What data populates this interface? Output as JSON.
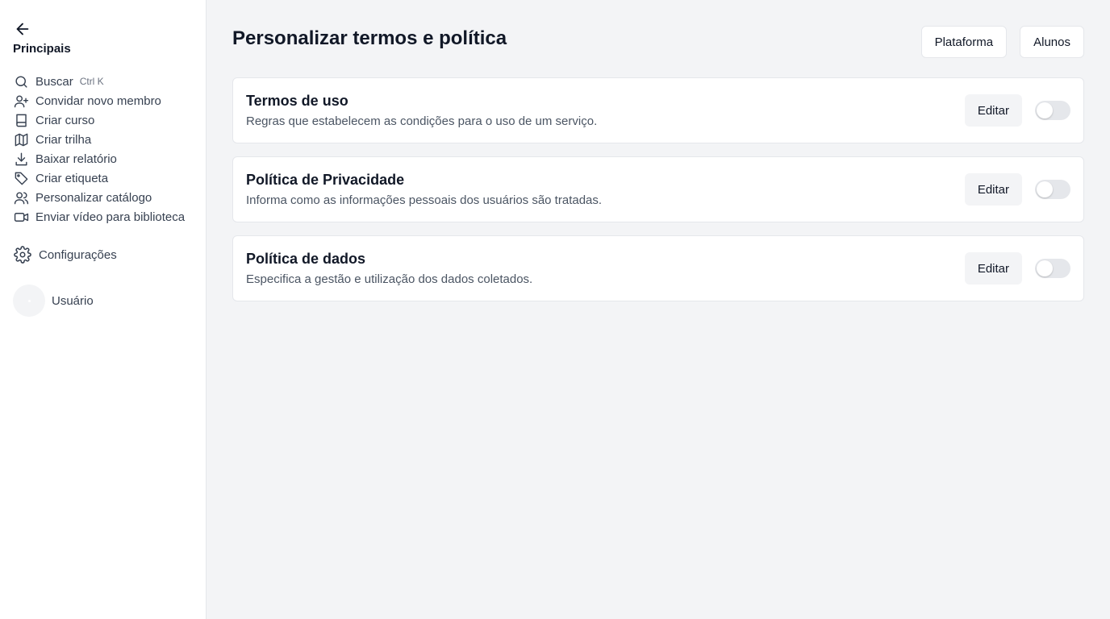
{
  "sidebar": {
    "section_title": "Principais",
    "items": [
      {
        "label": "Buscar",
        "icon": "search-icon",
        "shortcut": "Ctrl K"
      },
      {
        "label": "Convidar novo membro",
        "icon": "user-plus-icon"
      },
      {
        "label": "Criar curso",
        "icon": "book-icon"
      },
      {
        "label": "Criar trilha",
        "icon": "map-icon"
      },
      {
        "label": "Baixar relatório",
        "icon": "download-icon"
      },
      {
        "label": "Criar etiqueta",
        "icon": "tag-icon"
      },
      {
        "label": "Personalizar catálogo",
        "icon": "users-icon"
      },
      {
        "label": "Enviar vídeo para biblioteca",
        "icon": "video-icon"
      }
    ],
    "settings_label": "Configurações",
    "user_name": "Usuário"
  },
  "main": {
    "title": "Personalizar termos e política",
    "header_buttons": {
      "platform": "Plataforma",
      "students": "Alunos"
    },
    "cards": [
      {
        "title": "Termos de uso",
        "description": "Regras que estabelecem as condições para o uso de um serviço.",
        "edit_label": "Editar",
        "enabled": false
      },
      {
        "title": "Política de Privacidade",
        "description": "Informa como as informações pessoais dos usuários são tratadas.",
        "edit_label": "Editar",
        "enabled": false
      },
      {
        "title": "Política de dados",
        "description": "Especifica a gestão e utilização dos dados coletados.",
        "edit_label": "Editar",
        "enabled": false
      }
    ]
  },
  "colors": {
    "background": "#f3f4f6",
    "surface": "#ffffff",
    "border": "#e5e7eb",
    "text": "#111827",
    "muted_text": "#4b5563"
  }
}
